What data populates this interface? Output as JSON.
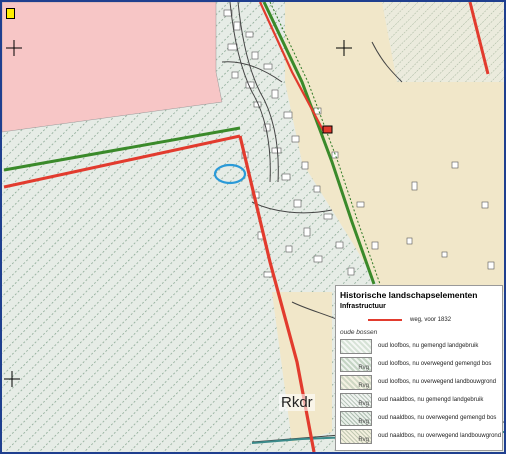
{
  "map": {
    "place_label": "Rkdr"
  },
  "legend": {
    "title": "Historische landschapselementen",
    "subtitle": "Infrastructuur",
    "road_label": "weg, voor 1832",
    "section_label": "oude bossen",
    "items": [
      {
        "label": "oud loofbos, nu gemengd landgebruik",
        "code": ""
      },
      {
        "label": "oud loofbos, nu overwegend gemengd bos",
        "code": "Rvg"
      },
      {
        "label": "oud loofbos, nu overwegend landbouwgrond",
        "code": "Rvg"
      },
      {
        "label": "oud naaldbos, nu gemengd landgebruik",
        "code": "Rvg"
      },
      {
        "label": "oud naaldbos, nu overwegend gemengd bos",
        "code": "Rvg"
      },
      {
        "label": "oud naaldbos, nu overwegend landbouwgrond",
        "code": "Rvg"
      }
    ]
  },
  "colors": {
    "road_red": "#e23b2e",
    "road_green": "#3a8a2a",
    "forest_hatch": "#7fa08a",
    "forest_bg": "#e6ece6",
    "pink_zone": "#f7c6c6",
    "field_tan": "#f1e7c9",
    "frame_blue": "#1f3f8f"
  }
}
